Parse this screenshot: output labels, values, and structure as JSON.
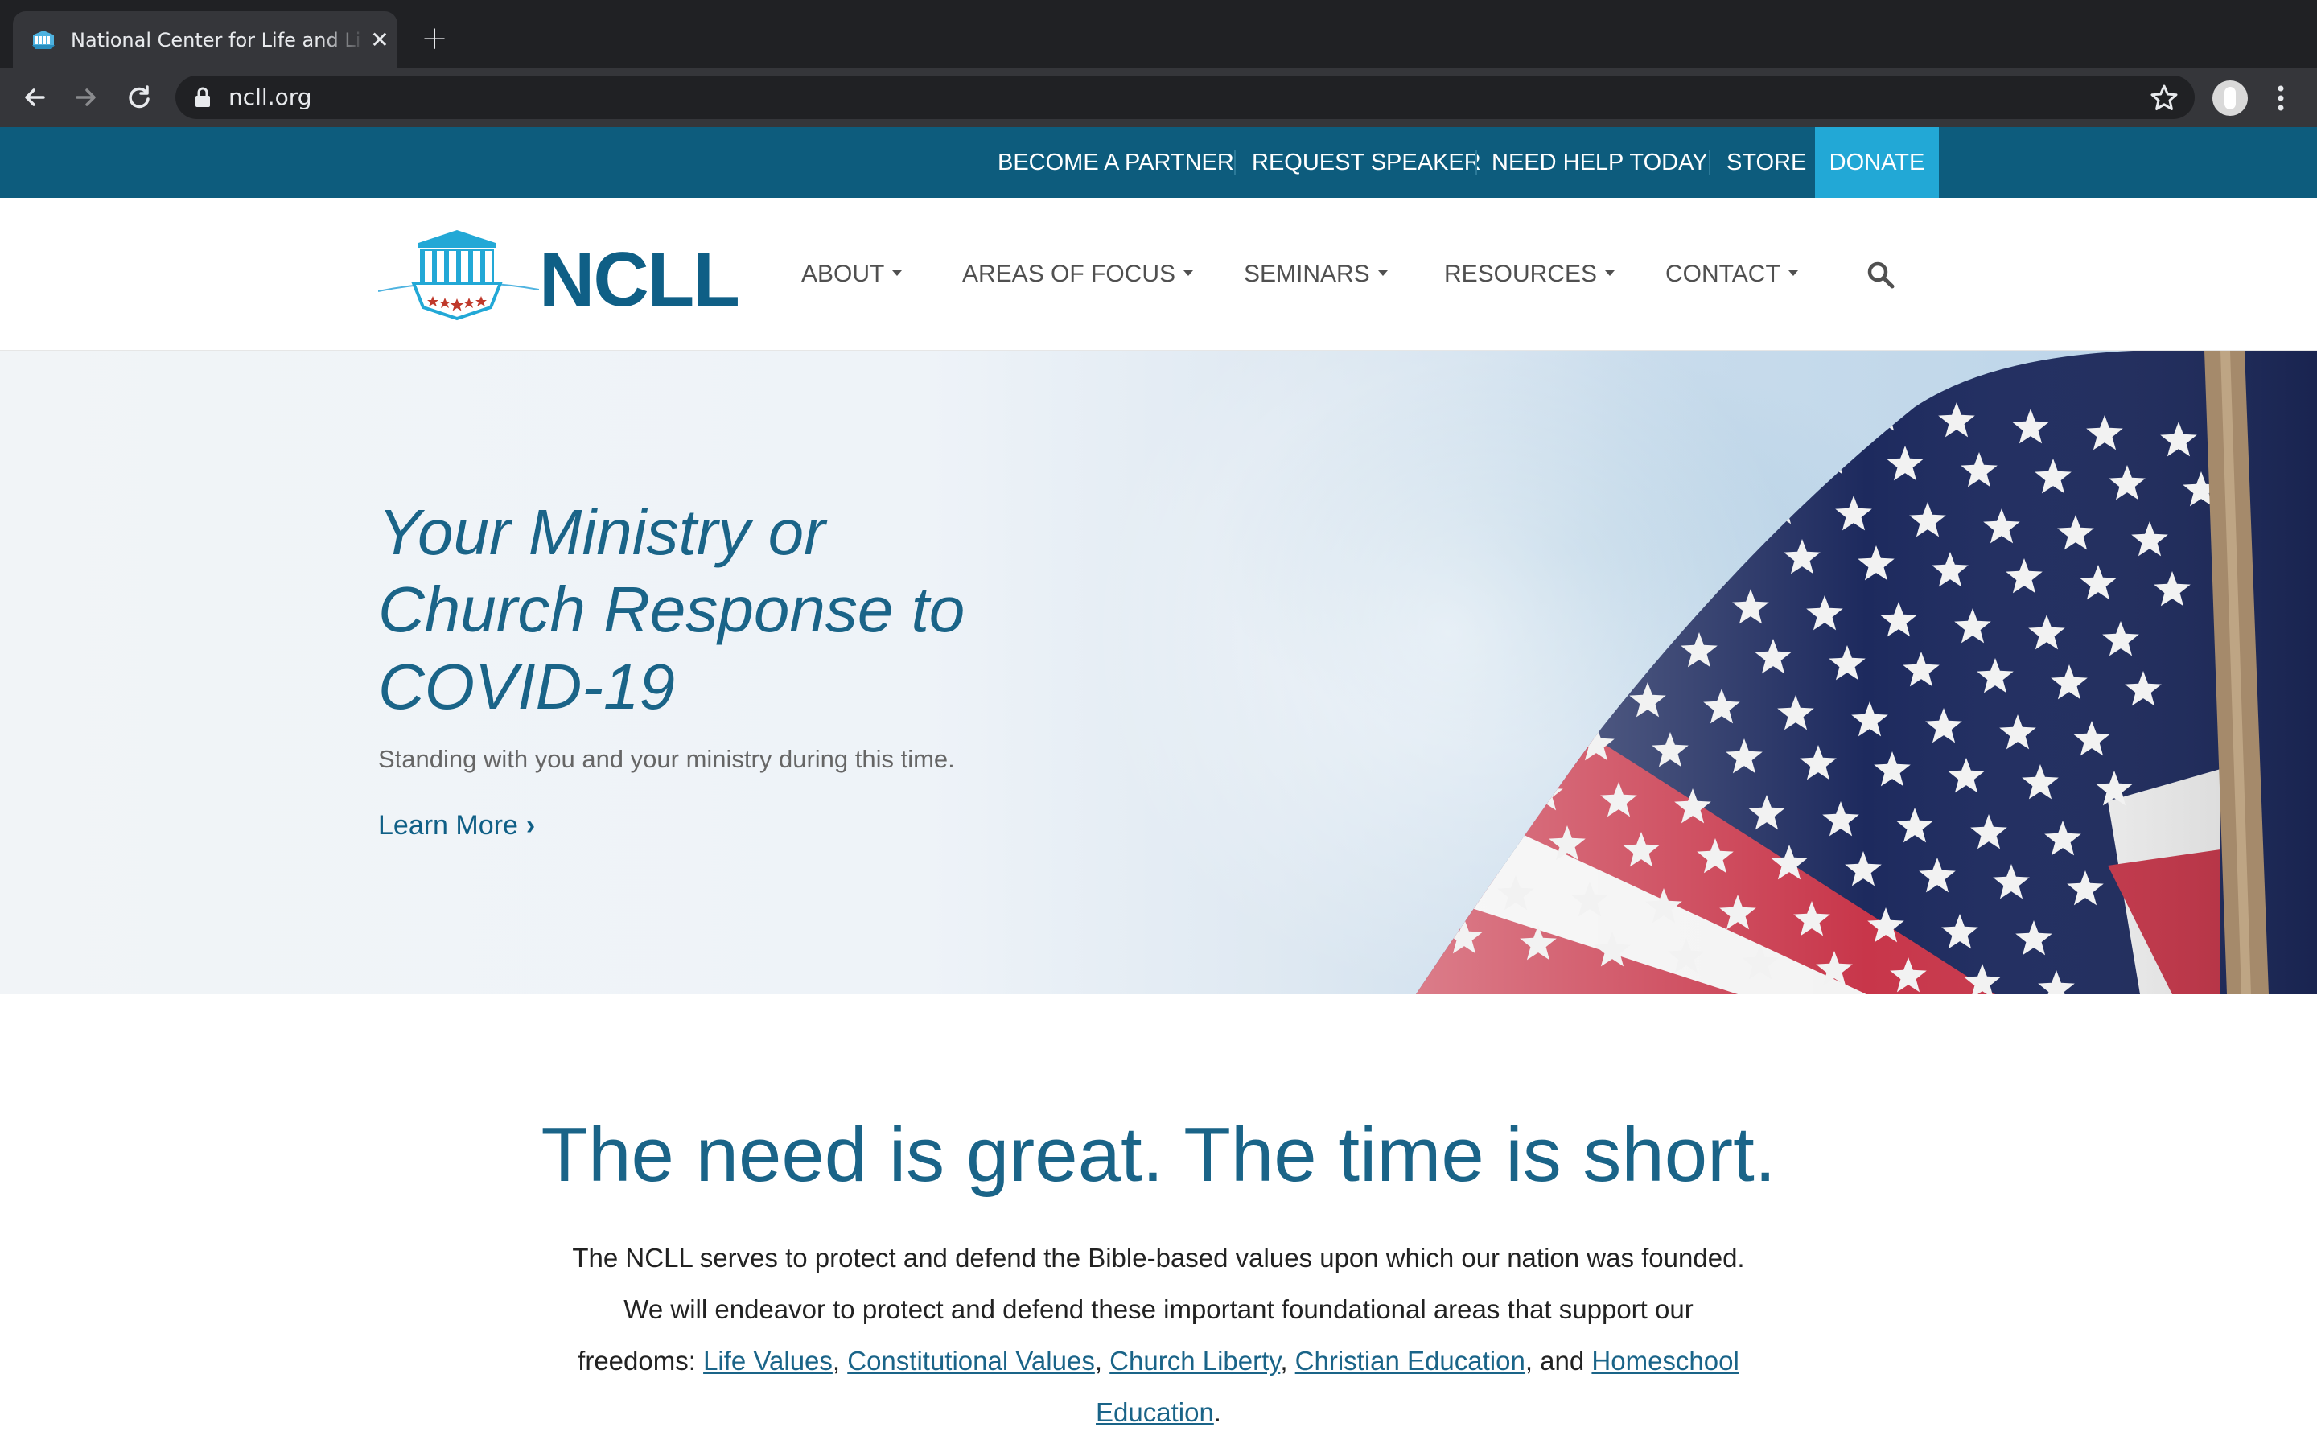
{
  "browser": {
    "tab_title": "National Center for Life and Liberty",
    "tab_close": "✕",
    "new_tab": "+",
    "url": "ncll.org"
  },
  "utility_nav": {
    "items": [
      "BECOME A PARTNER",
      "REQUEST SPEAKER",
      "NEED HELP TODAY",
      "STORE"
    ],
    "donate": "DONATE"
  },
  "header": {
    "logo_text": "NCLL",
    "nav": [
      "ABOUT",
      "AREAS OF FOCUS",
      "SEMINARS",
      "RESOURCES",
      "CONTACT"
    ]
  },
  "hero": {
    "title_lines": [
      "Your Ministry or",
      "Church Response to",
      "COVID-19"
    ],
    "subtitle": "Standing with you and your ministry during this time.",
    "link_label": "Learn More",
    "link_chevron": "›"
  },
  "intro": {
    "title": "The need is great. The time is short.",
    "body_prefix": "The NCLL serves to protect and defend the Bible-based values upon which our nation was founded. We will endeavor to protect and defend these important foundational areas that support our freedoms: ",
    "links": [
      "Life Values",
      "Constitutional Values",
      "Church Liberty",
      "Christian Education",
      "Homeschool Education"
    ],
    "sep_comma": ", ",
    "sep_and": ", and ",
    "body_suffix": "."
  },
  "colors": {
    "utility_bar": "#0d5c7d",
    "donate": "#22a8d6",
    "brand_blue": "#0f5f86",
    "heading_blue": "#1a6488"
  },
  "icons": [
    "back-arrow-icon",
    "forward-arrow-icon",
    "reload-icon",
    "lock-icon",
    "star-icon",
    "profile-avatar-icon",
    "kebab-menu-icon",
    "search-icon",
    "chevron-right-icon",
    "caret-down-icon"
  ]
}
